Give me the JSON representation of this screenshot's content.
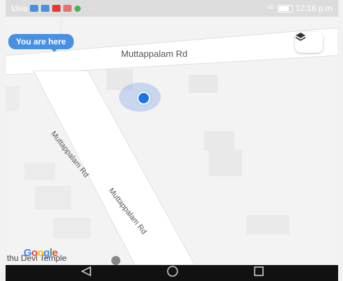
{
  "status_bar": {
    "carrier": "Idea",
    "dots": "···",
    "signal": "⁴ᴳ",
    "time": "12:16 p.m",
    "notification_colors": [
      "#4a90e2",
      "#4a90e2",
      "#e53935",
      "#e57373",
      "#4caf50"
    ]
  },
  "map": {
    "you_are_here": "You are here",
    "road_top": "Muttappalam Rd",
    "road_diag_1": "Muttappalam Rd",
    "road_diag_2": "Muttappalam Rd",
    "place_label": "thu Devi Temple",
    "google_logo": [
      "G",
      "o",
      "o",
      "g",
      "l",
      "e"
    ],
    "google_colors": [
      "#4285f4",
      "#ea4335",
      "#fbbc05",
      "#4285f4",
      "#34a853",
      "#ea4335"
    ],
    "location_color": "#1a73e8",
    "layers_icon": "layers-icon"
  },
  "nav_bar": {
    "back_icon": "back-triangle-icon",
    "home_icon": "home-circle-icon",
    "recents_icon": "recents-square-icon"
  }
}
